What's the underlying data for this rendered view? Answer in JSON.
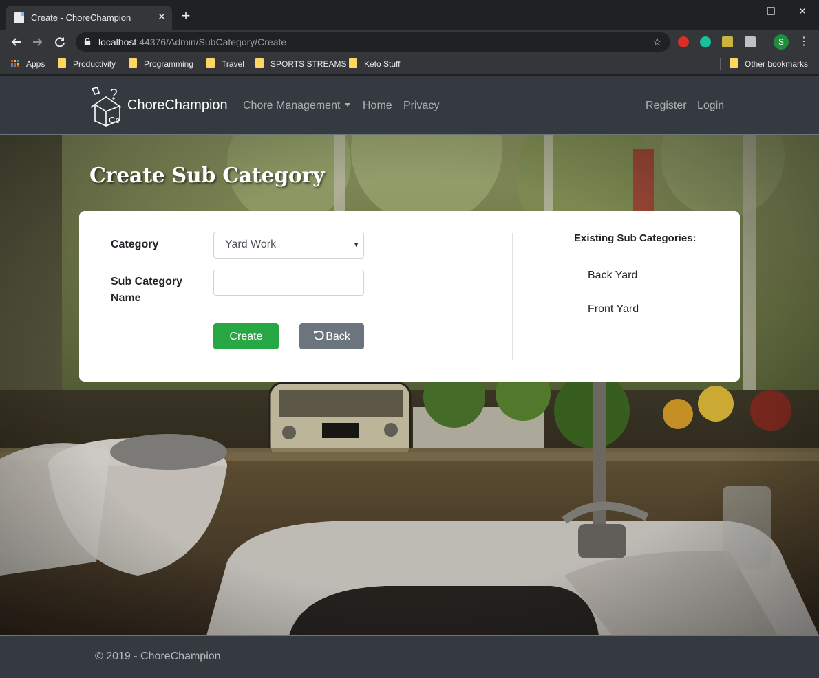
{
  "browser": {
    "tab_title": "Create - ChoreChampion",
    "url_host": "localhost",
    "url_path": ":44376/Admin/SubCategory/Create",
    "bookmarks": [
      {
        "label": "Apps"
      },
      {
        "label": "Productivity"
      },
      {
        "label": "Programming"
      },
      {
        "label": "Travel"
      },
      {
        "label": "SPORTS STREAMS"
      },
      {
        "label": "Keto Stuff"
      }
    ],
    "other_bookmarks": "Other bookmarks",
    "profile_initial": "S"
  },
  "navbar": {
    "brand": "ChoreChampion",
    "logo_text": "Cc",
    "links": {
      "chore_management": "Chore Management",
      "home": "Home",
      "privacy": "Privacy",
      "register": "Register",
      "login": "Login"
    }
  },
  "page": {
    "title": "Create Sub Category",
    "form": {
      "category_label": "Category",
      "category_value": "Yard Work",
      "subcategory_label_line1": "Sub Category",
      "subcategory_label_line2": "Name",
      "subcategory_value": "",
      "create_label": "Create",
      "back_label": "Back"
    },
    "existing": {
      "title": "Existing Sub Categories:",
      "items": [
        "Back Yard",
        "Front Yard"
      ]
    }
  },
  "footer": {
    "text": "© 2019 - ChoreChampion"
  },
  "colors": {
    "navbar_bg": "#343a40",
    "success": "#28a745",
    "secondary": "#6c757d"
  }
}
